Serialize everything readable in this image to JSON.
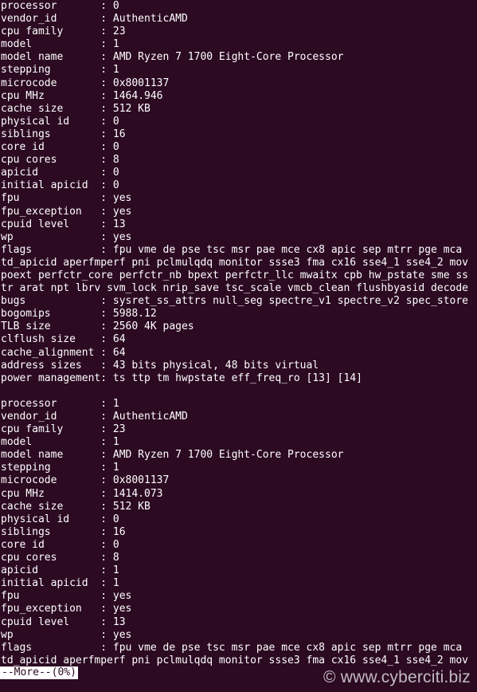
{
  "terminal": {
    "lines": [
      "processor       : 0",
      "vendor_id       : AuthenticAMD",
      "cpu family      : 23",
      "model           : 1",
      "model name      : AMD Ryzen 7 1700 Eight-Core Processor",
      "stepping        : 1",
      "microcode       : 0x8001137",
      "cpu MHz         : 1464.946",
      "cache size      : 512 KB",
      "physical id     : 0",
      "siblings        : 16",
      "core id         : 0",
      "cpu cores       : 8",
      "apicid          : 0",
      "initial apicid  : 0",
      "fpu             : yes",
      "fpu_exception   : yes",
      "cpuid level     : 13",
      "wp              : yes",
      "flags           : fpu vme de pse tsc msr pae mce cx8 apic sep mtrr pge mca",
      "td_apicid aperfmperf pni pclmulqdq monitor ssse3 fma cx16 sse4_1 sse4_2 mov",
      "poext perfctr_core perfctr_nb bpext perfctr_llc mwaitx cpb hw_pstate sme ss",
      "tr arat npt lbrv svm_lock nrip_save tsc_scale vmcb_clean flushbyasid decode",
      "bugs            : sysret_ss_attrs null_seg spectre_v1 spectre_v2 spec_store",
      "bogomips        : 5988.12",
      "TLB size        : 2560 4K pages",
      "clflush size    : 64",
      "cache_alignment : 64",
      "address sizes   : 43 bits physical, 48 bits virtual",
      "power management: ts ttp tm hwpstate eff_freq_ro [13] [14]",
      "",
      "processor       : 1",
      "vendor_id       : AuthenticAMD",
      "cpu family      : 23",
      "model           : 1",
      "model name      : AMD Ryzen 7 1700 Eight-Core Processor",
      "stepping        : 1",
      "microcode       : 0x8001137",
      "cpu MHz         : 1414.073",
      "cache size      : 512 KB",
      "physical id     : 0",
      "siblings        : 16",
      "core id         : 0",
      "cpu cores       : 8",
      "apicid          : 1",
      "initial apicid  : 1",
      "fpu             : yes",
      "fpu_exception   : yes",
      "cpuid level     : 13",
      "wp              : yes",
      "flags           : fpu vme de pse tsc msr pae mce cx8 apic sep mtrr pge mca",
      "td_apicid aperfmperf pni pclmulqdq monitor ssse3 fma cx16 sse4_1 sse4_2 mov"
    ],
    "pager_prompt": "--More--(0%)",
    "watermark": "© www.cyberciti.biz"
  },
  "colors": {
    "background": "#2c0a22",
    "foreground": "#ffffff"
  }
}
